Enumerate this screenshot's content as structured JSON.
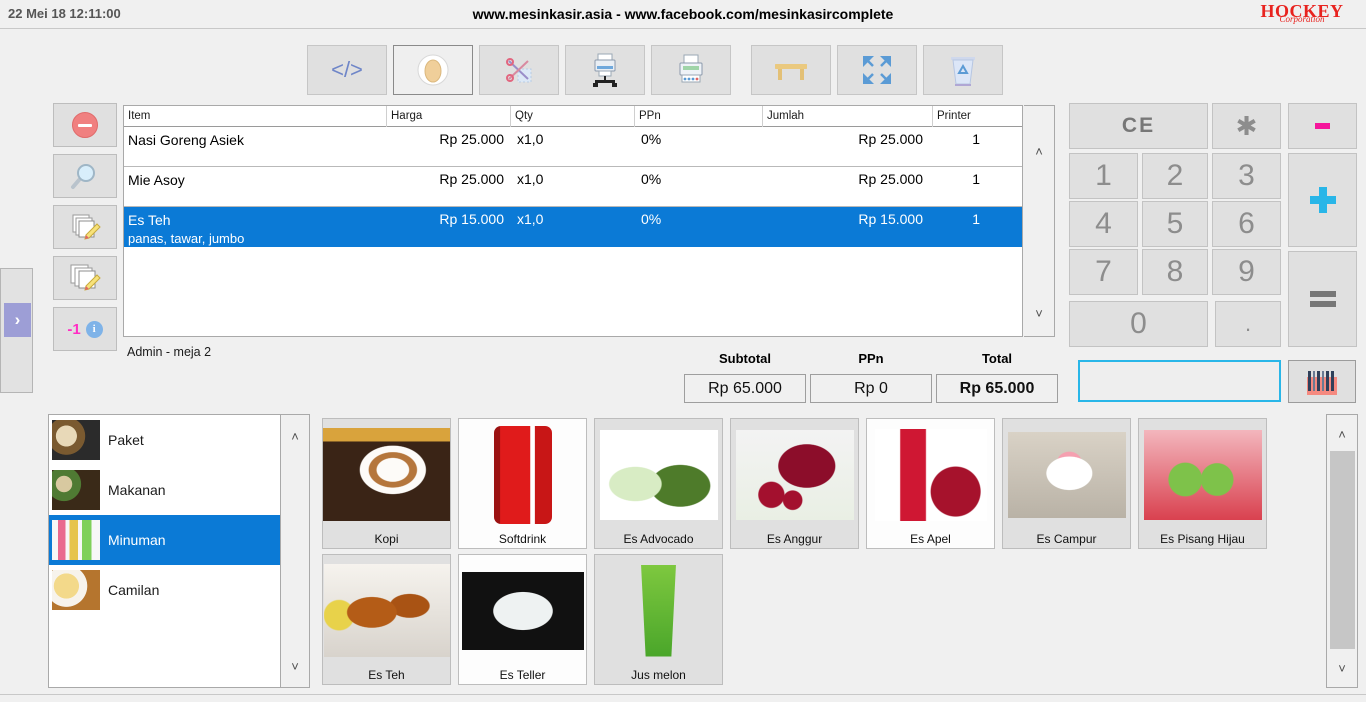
{
  "titlebar": {
    "clock": "22 Mei 18 12:11:00",
    "site_title": "www.mesinkasir.asia - www.facebook.com/mesinkasircomplete",
    "logo_main": "HOCKEY",
    "logo_sub": "Corporation"
  },
  "toolbar": {
    "buttons": [
      {
        "name": "code-button",
        "icon": "code-brackets-icon",
        "glyph": "〈/〉",
        "selected": false
      },
      {
        "name": "member-button",
        "icon": "avatar-icon",
        "glyph": "",
        "selected": true
      },
      {
        "name": "cut-button",
        "icon": "scissors-icon",
        "glyph": "✂",
        "selected": false
      },
      {
        "name": "network-printer-button",
        "icon": "network-printer-icon",
        "glyph": "",
        "selected": false
      },
      {
        "name": "print-button",
        "icon": "printer-icon",
        "glyph": "",
        "selected": false
      },
      {
        "name": "table-button",
        "icon": "table-desk-icon",
        "glyph": "",
        "selected": false
      },
      {
        "name": "fullscreen-button",
        "icon": "fullscreen-arrows-icon",
        "glyph": "",
        "selected": false
      },
      {
        "name": "trash-button",
        "icon": "recycle-bin-icon",
        "glyph": "",
        "selected": false
      }
    ]
  },
  "left_tools": {
    "buttons": [
      {
        "name": "remove-item-button",
        "icon": "circle-minus-icon"
      },
      {
        "name": "search-button",
        "icon": "magnifier-icon"
      },
      {
        "name": "copy-edit-button",
        "icon": "copy-pencil-icon"
      },
      {
        "name": "duplicate-edit-button",
        "icon": "duplicate-pencil-icon"
      },
      {
        "name": "decrement-button",
        "icon": "info-icon",
        "label": "-1"
      }
    ]
  },
  "edge_panel": {
    "expand_label": "›"
  },
  "cart": {
    "columns": [
      "Item",
      "Harga",
      "Qty",
      "PPn",
      "Jumlah",
      "Printer"
    ],
    "rows": [
      {
        "item": "Nasi Goreng Asiek",
        "note": "",
        "harga": "Rp 25.000",
        "qty": "x1,0",
        "ppn": "0%",
        "jumlah": "Rp 25.000",
        "printer": "1",
        "selected": false
      },
      {
        "item": "Mie Asoy",
        "note": "",
        "harga": "Rp 25.000",
        "qty": "x1,0",
        "ppn": "0%",
        "jumlah": "Rp 25.000",
        "printer": "1",
        "selected": false
      },
      {
        "item": "Es Teh",
        "note": "panas, tawar, jumbo",
        "harga": "Rp 15.000",
        "qty": "x1,0",
        "ppn": "0%",
        "jumlah": "Rp 15.000",
        "printer": "1",
        "selected": true
      }
    ],
    "scroll_up": "˄",
    "scroll_down": "˅"
  },
  "summary": {
    "admin": "Admin - meja 2",
    "subtotal_label": "Subtotal",
    "subtotal_value": "Rp 65.000",
    "ppn_label": "PPn",
    "ppn_value": "Rp 0",
    "total_label": "Total",
    "total_value": "Rp 65.000"
  },
  "keypad": {
    "clear_label": "CE",
    "star_label": "✱",
    "minus_label": "-",
    "plus_label": "+",
    "equals_label": "=",
    "keys": [
      "1",
      "2",
      "3",
      "4",
      "5",
      "6",
      "7",
      "8",
      "9",
      "0",
      "."
    ]
  },
  "entry": {
    "value": "",
    "placeholder": ""
  },
  "barcode": {
    "name": "barcode-scan-button"
  },
  "categories": {
    "items": [
      {
        "label": "Paket",
        "selected": false
      },
      {
        "label": "Makanan",
        "selected": false
      },
      {
        "label": "Minuman",
        "selected": true
      },
      {
        "label": "Camilan",
        "selected": false
      }
    ]
  },
  "products": {
    "items": [
      {
        "label": "Kopi"
      },
      {
        "label": "Softdrink"
      },
      {
        "label": "Es Advocado"
      },
      {
        "label": "Es Anggur"
      },
      {
        "label": "Es Apel"
      },
      {
        "label": "Es Campur"
      },
      {
        "label": "Es Pisang Hijau"
      },
      {
        "label": "Es Teh"
      },
      {
        "label": "Es Teller"
      },
      {
        "label": "Jus melon"
      }
    ]
  },
  "colors": {
    "selection_blue": "#0b7ad6",
    "accent_cyan": "#29b6e8",
    "accent_pink": "#f5169b",
    "logo_red": "#e8231f",
    "panel_gray": "#e0e0e0"
  }
}
